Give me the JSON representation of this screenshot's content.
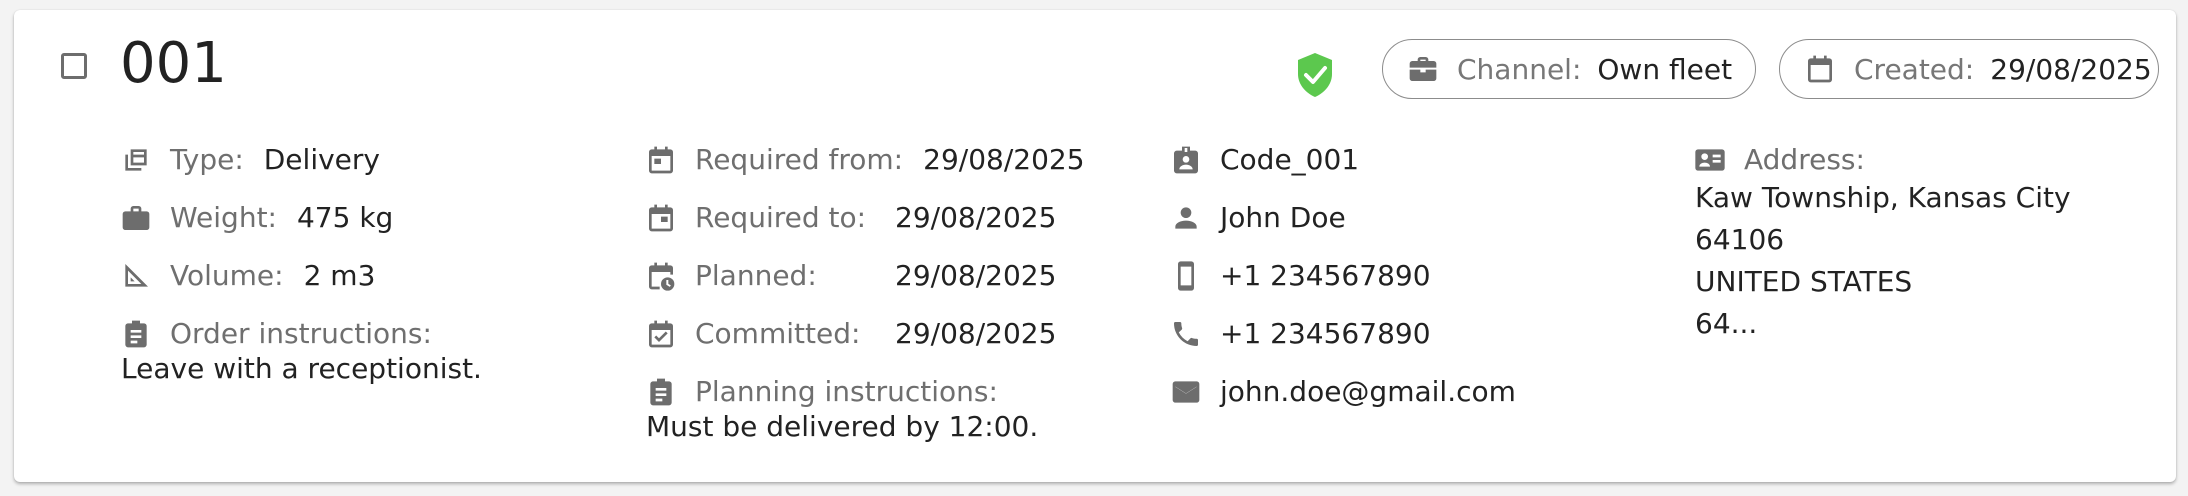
{
  "order": {
    "id": "001",
    "channel_label": "Channel:",
    "channel_value": "Own fleet",
    "created_label": "Created:",
    "created_value": "29/08/2025",
    "status_color": "#5cc84e"
  },
  "details": {
    "type_label": "Type:",
    "type_value": "Delivery",
    "weight_label": "Weight:",
    "weight_value": "475 kg",
    "volume_label": "Volume:",
    "volume_value": "2 m3",
    "order_instructions_label": "Order instructions:",
    "order_instructions_value": "Leave with a receptionist."
  },
  "schedule": {
    "required_from_label": "Required from:",
    "required_from_value": "29/08/2025",
    "required_to_label": "Required to:",
    "required_to_value": "29/08/2025",
    "planned_label": "Planned:",
    "planned_value": "29/08/2025",
    "committed_label": "Committed:",
    "committed_value": "29/08/2025",
    "planning_instructions_label": "Planning instructions:",
    "planning_instructions_value": "Must be delivered by 12:00."
  },
  "contact": {
    "code": "Code_001",
    "name": "John Doe",
    "mobile": "+1 234567890",
    "phone": "+1 234567890",
    "email": "john.doe@gmail.com"
  },
  "address": {
    "label": "Address:",
    "lines": [
      "Kaw Township, Kansas City",
      "64106",
      "UNITED STATES",
      "64..."
    ]
  },
  "icons": {
    "type": "layers-icon",
    "weight": "briefcase-icon",
    "volume": "ruler-triangle-icon",
    "instructions": "clipboard-icon",
    "calendar": "calendar-icon",
    "contact_card": "badge-icon",
    "person": "person-icon",
    "mobile": "smartphone-icon",
    "phone": "phone-icon",
    "email": "mail-icon",
    "address": "id-card-icon",
    "status": "shield-check-icon"
  }
}
